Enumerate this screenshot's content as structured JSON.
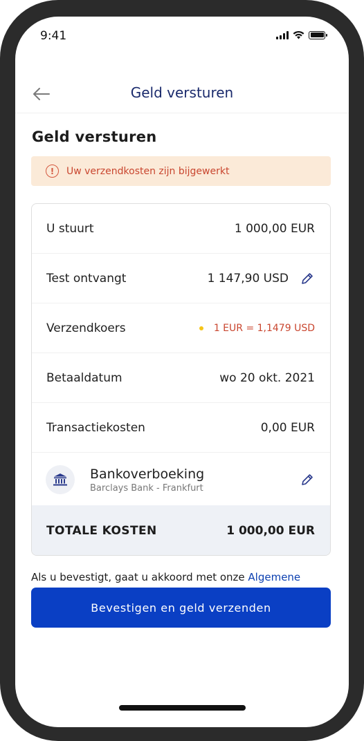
{
  "status_bar": {
    "time": "9:41"
  },
  "header": {
    "title": "Geld versturen"
  },
  "page": {
    "title": "Geld versturen"
  },
  "alert": {
    "text": "Uw verzendkosten zijn bijgewerkt",
    "icon": "exclamation-circle-icon"
  },
  "summary": {
    "rows": [
      {
        "label": "U stuurt",
        "value": "1 000,00 EUR"
      },
      {
        "label": "Test ontvangt",
        "value": "1 147,90 USD"
      },
      {
        "label": "Verzendkoers",
        "value": "1 EUR = 1,1479 USD"
      },
      {
        "label": "Betaaldatum",
        "value": "wo 20 okt. 2021"
      },
      {
        "label": "Transactiekosten",
        "value": "0,00 EUR"
      }
    ],
    "payment_method": {
      "name": "Bankoverboeking",
      "detail": "Barclays Bank - Frankfurt"
    },
    "total": {
      "label": "TOTALE KOSTEN",
      "value": "1 000,00 EUR"
    }
  },
  "terms": {
    "text": "Als u bevestigt, gaat u akkoord met onze ",
    "link": "Algemene"
  },
  "cta": {
    "label": "Bevestigen en geld verzenden"
  },
  "colors": {
    "brand_blue": "#0a3fc4",
    "header_title": "#1a2a6c",
    "alert_bg": "#fbead8",
    "alert_text": "#c9462f",
    "rate_dot": "#f5c518",
    "total_bg": "#eef1f6"
  }
}
